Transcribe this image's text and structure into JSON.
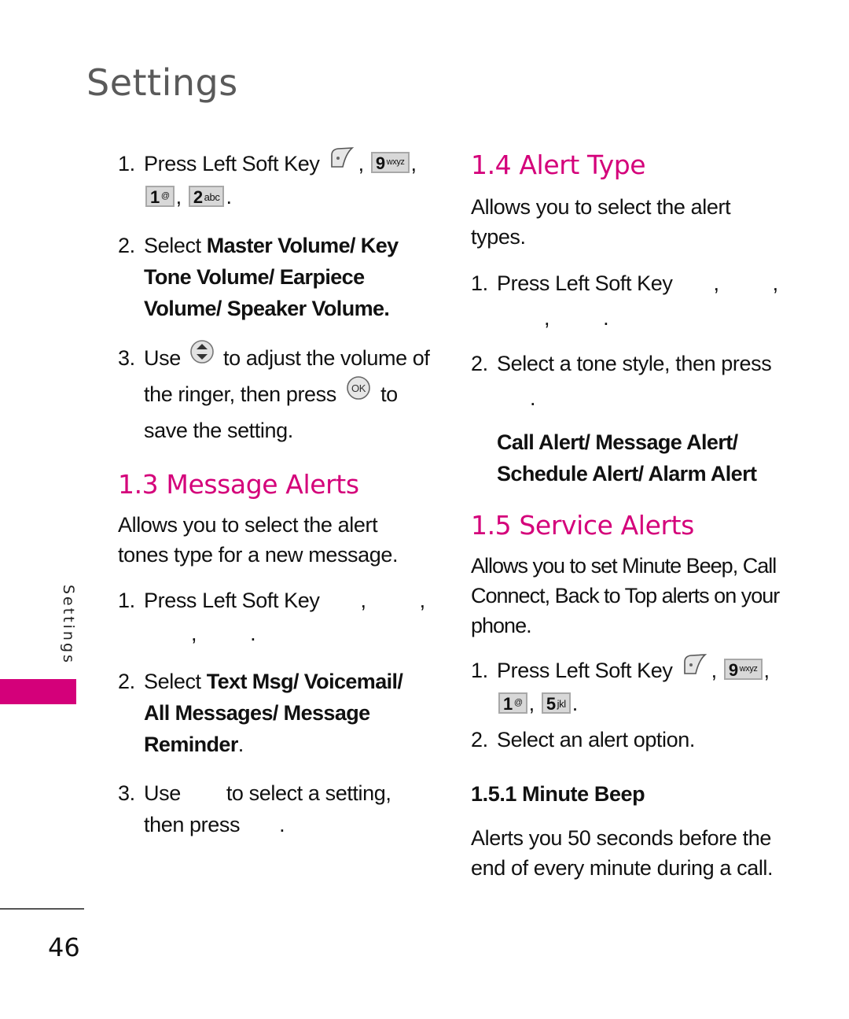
{
  "page": {
    "title": "Settings",
    "side_label": "Settings",
    "page_number": "46",
    "accent_color": "#d4007a"
  },
  "left": {
    "volume_steps": [
      {
        "num": "1.",
        "text": "Press Left Soft Key",
        "keys": [
          "left-soft-key",
          "9 wxyz",
          "1 voicemail",
          "2 abc"
        ]
      },
      {
        "num": "2.",
        "prefix": "Select ",
        "bold": "Master Volume/ Key Tone Volume/ Earpiece Volume/ Speaker Volume",
        "suffix": "."
      },
      {
        "num": "3.",
        "text_a": "Use",
        "text_b": "to adjust the volume of the ringer, then press",
        "text_c": "to save the setting."
      }
    ],
    "message_alerts": {
      "heading": "1.3 Message Alerts",
      "description": "Allows you to select the alert tones type for a new message.",
      "steps": [
        {
          "num": "1.",
          "text": "Press Left Soft Key"
        },
        {
          "num": "2.",
          "prefix": "Select ",
          "bold": "Text Msg/ Voicemail/ All Messages/ Message Reminder",
          "suffix": "."
        },
        {
          "num": "3.",
          "text_a": "Use",
          "text_b": "to select a setting, then press",
          "text_c": "."
        }
      ]
    }
  },
  "right": {
    "alert_type": {
      "heading": "1.4 Alert  Type",
      "description": "Allows you to select the alert types.",
      "steps": [
        {
          "num": "1.",
          "text": "Press Left Soft Key"
        },
        {
          "num": "2.",
          "text": "Select a tone style, then press"
        }
      ],
      "options": "Call Alert/ Message Alert/ Schedule Alert/ Alarm Alert"
    },
    "service_alerts": {
      "heading": "1.5 Service Alerts",
      "description": "Allows you to set Minute Beep, Call Connect, Back to Top alerts on your phone.",
      "steps": [
        {
          "num": "1.",
          "text": "Press Left Soft Key",
          "keys": [
            "left-soft-key",
            "9 wxyz",
            "1 voicemail",
            "5 jkl"
          ]
        },
        {
          "num": "2.",
          "text": "Select an alert option."
        }
      ]
    },
    "minute_beep": {
      "heading": "1.5.1 Minute Beep",
      "description": "Alerts you 50 seconds before the end of every minute during a call."
    }
  },
  "keys": {
    "k9": {
      "digit": "9",
      "letters": "wxyz"
    },
    "k1": {
      "digit": "1",
      "letters": "@"
    },
    "k2": {
      "digit": "2",
      "letters": "abc"
    },
    "k5": {
      "digit": "5",
      "letters": "jkl"
    },
    "ok": "OK"
  }
}
